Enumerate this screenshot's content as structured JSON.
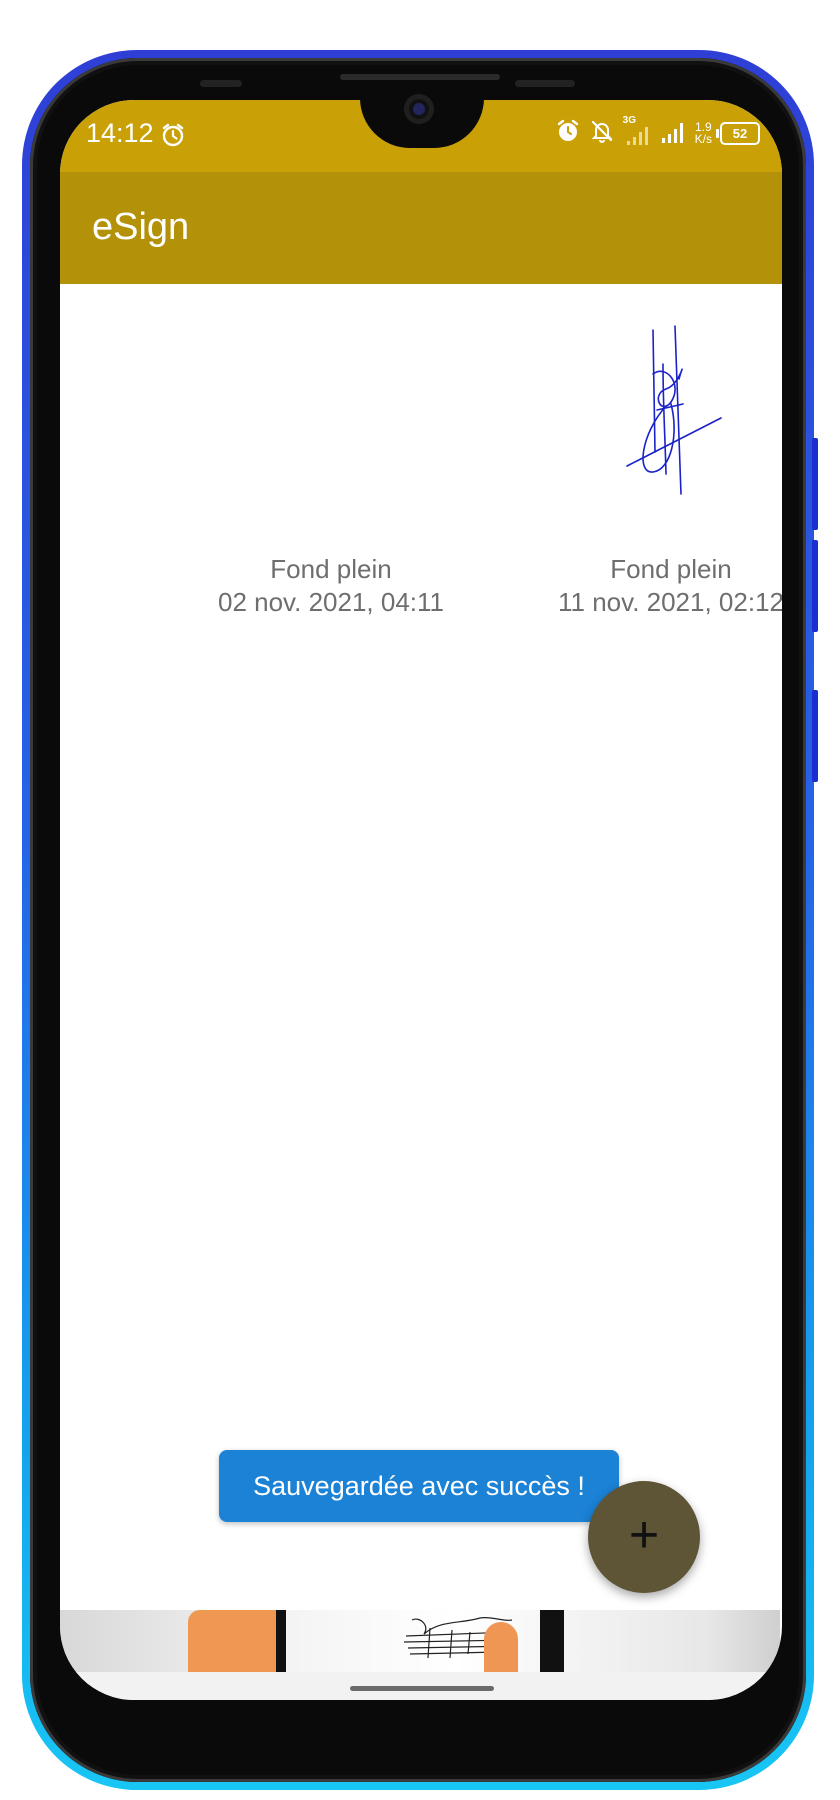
{
  "status_bar": {
    "time": "14:12",
    "network_speed_value": "1.9",
    "network_speed_unit": "K/s",
    "battery": "52",
    "signal_label": "3G"
  },
  "app_bar": {
    "title": "eSign"
  },
  "signatures": [
    {
      "title": "Fond plein",
      "date": "02 nov. 2021, 04:11"
    },
    {
      "title": "Fond plein",
      "date": "11 nov. 2021, 02:12"
    }
  ],
  "toast": {
    "message": "Sauvegardée avec succès !"
  },
  "fab": {
    "icon": "+"
  },
  "colors": {
    "status_bar": "#c9a006",
    "app_bar": "#b39108",
    "toast": "#1b82d6",
    "fab": "#5e5436",
    "signature_ink": "#1a22c8"
  }
}
